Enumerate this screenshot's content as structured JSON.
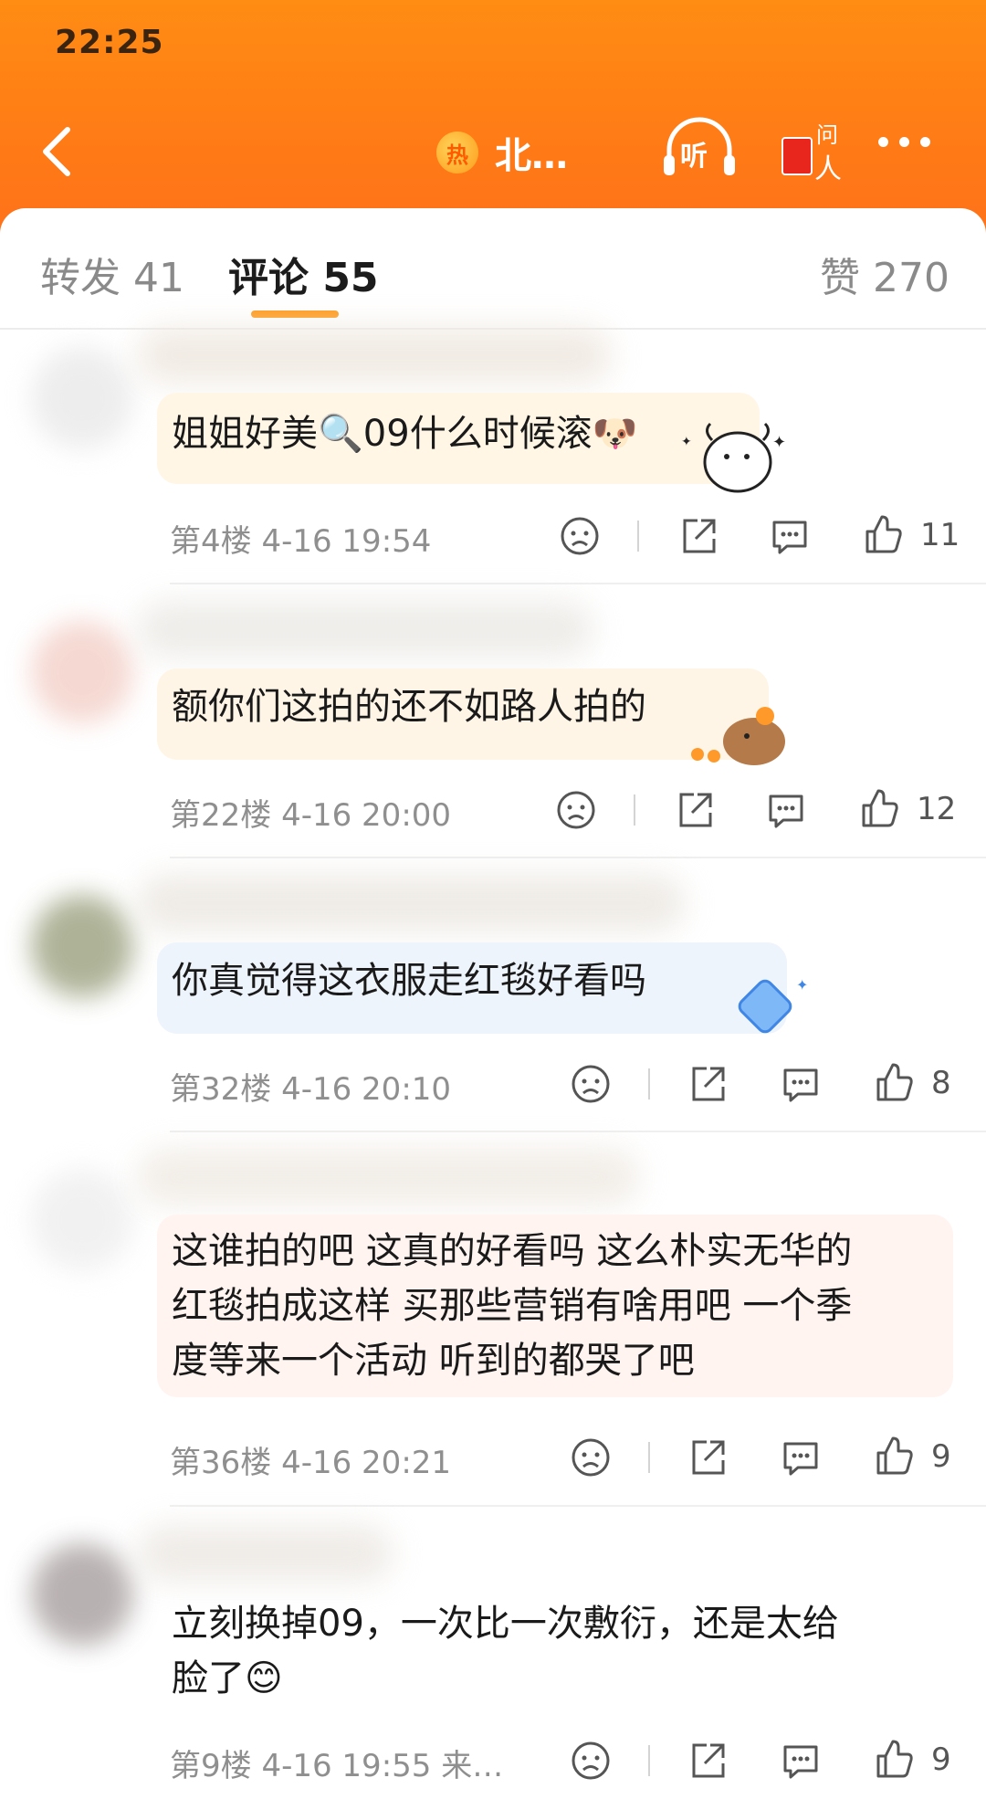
{
  "status_bar": {
    "time": "22:25"
  },
  "header": {
    "hot_badge": "热",
    "title": "北…",
    "listen_label": "听",
    "ask_label_top": "问",
    "ask_label_bottom": "人"
  },
  "tabs": {
    "repost": "转发 41",
    "comment": "评论 55",
    "likes": "赞 270"
  },
  "comments": [
    {
      "text": "姐姐好美🔍09什么时候滚🐶",
      "floor": "第4楼",
      "time": "4-16 19:54",
      "location": "",
      "likes": "11"
    },
    {
      "text": "额你们这拍的还不如路人拍的",
      "floor": "第22楼",
      "time": "4-16 20:00",
      "location": "",
      "likes": "12"
    },
    {
      "text": "你真觉得这衣服走红毯好看吗",
      "floor": "第32楼",
      "time": "4-16 20:10",
      "location": "",
      "likes": "8"
    },
    {
      "text": "这谁拍的吧 这真的好看吗 这么朴实无华的\n红毯拍成这样 买那些营销有啥用吧 一个季\n度等来一个活动 听到的都哭了吧",
      "floor": "第36楼",
      "time": "4-16 20:21",
      "location": "",
      "likes": "9"
    },
    {
      "text": "立刻换掉09，一次比一次敷衍，还是太给\n脸了😊",
      "floor": "第9楼",
      "time": "4-16 19:55",
      "location": "来…",
      "likes": "9"
    }
  ],
  "colors": {
    "header_orange": "#ff8010",
    "tab_active": "#1c1c1c",
    "tab_underline": "#ff9a1c",
    "meta_gray": "#8f8f8f"
  }
}
